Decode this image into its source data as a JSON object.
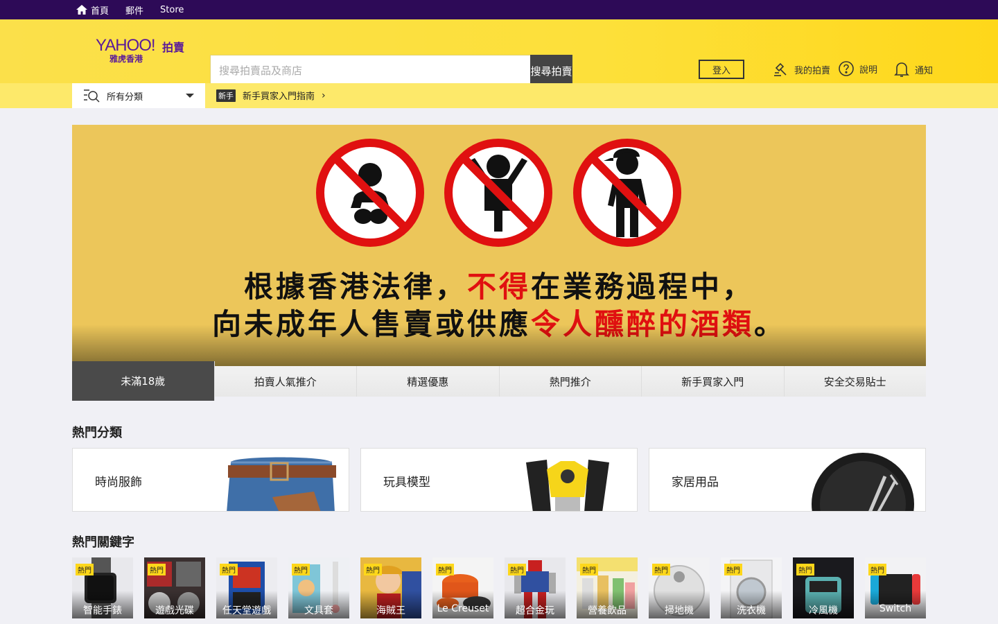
{
  "topbar": {
    "home_label": "首頁",
    "mail_label": "郵件",
    "store_label": "Store"
  },
  "header": {
    "logo_brand": "YAHOO!",
    "logo_auction": "拍賣",
    "logo_sub": "雅虎香港",
    "search_placeholder": "搜尋拍賣品及商店",
    "search_button": "搜尋拍賣",
    "login_button": "登入",
    "links": {
      "my_auction": "我的拍賣",
      "help": "說明",
      "notify": "通知"
    }
  },
  "subnav": {
    "category_label": "所有分類",
    "new_user_tag": "新手",
    "new_user_label": "新手買家入門指南"
  },
  "banner": {
    "line1_a": "根據香港法律，",
    "line1_red": "不得",
    "line1_b": "在業務過程中，",
    "line2_a": "向未成年人售賣或供應",
    "line2_red": "令人醺醉的酒類",
    "line2_b": "。",
    "colors": {
      "background": "#ecc65a",
      "accent": "#e01010"
    }
  },
  "banner_tabs": [
    {
      "label": "未滿18歲",
      "active": true
    },
    {
      "label": "拍賣人氣推介",
      "active": false
    },
    {
      "label": "精選優惠",
      "active": false
    },
    {
      "label": "熱門推介",
      "active": false
    },
    {
      "label": "新手買家入門",
      "active": false
    },
    {
      "label": "安全交易貼士",
      "active": false
    }
  ],
  "sections": {
    "featured_title": "熱門分類",
    "hot_title": "熱門關鍵字"
  },
  "featured_cards": [
    {
      "title": "時尚服飾",
      "icon": "jeans-belt-icon"
    },
    {
      "title": "玩具模型",
      "icon": "robot-toy-icon"
    },
    {
      "title": "家居用品",
      "icon": "frying-pan-icon"
    }
  ],
  "hot_items": [
    {
      "badge": "熱門",
      "label": "智能手錶"
    },
    {
      "badge": "熱門",
      "label": "遊戲光碟"
    },
    {
      "badge": "熱門",
      "label": "任天堂遊戲"
    },
    {
      "badge": "熱門",
      "label": "文具套"
    },
    {
      "badge": "熱門",
      "label": "海賊王"
    },
    {
      "badge": "熱門",
      "label": "Le Creuset"
    },
    {
      "badge": "熱門",
      "label": "超合金玩"
    },
    {
      "badge": "熱門",
      "label": "營養飲品"
    },
    {
      "badge": "熱門",
      "label": "掃地機"
    },
    {
      "badge": "熱門",
      "label": "洗衣機"
    },
    {
      "badge": "熱門",
      "label": "冷風機"
    },
    {
      "badge": "熱門",
      "label": "Switch"
    }
  ]
}
